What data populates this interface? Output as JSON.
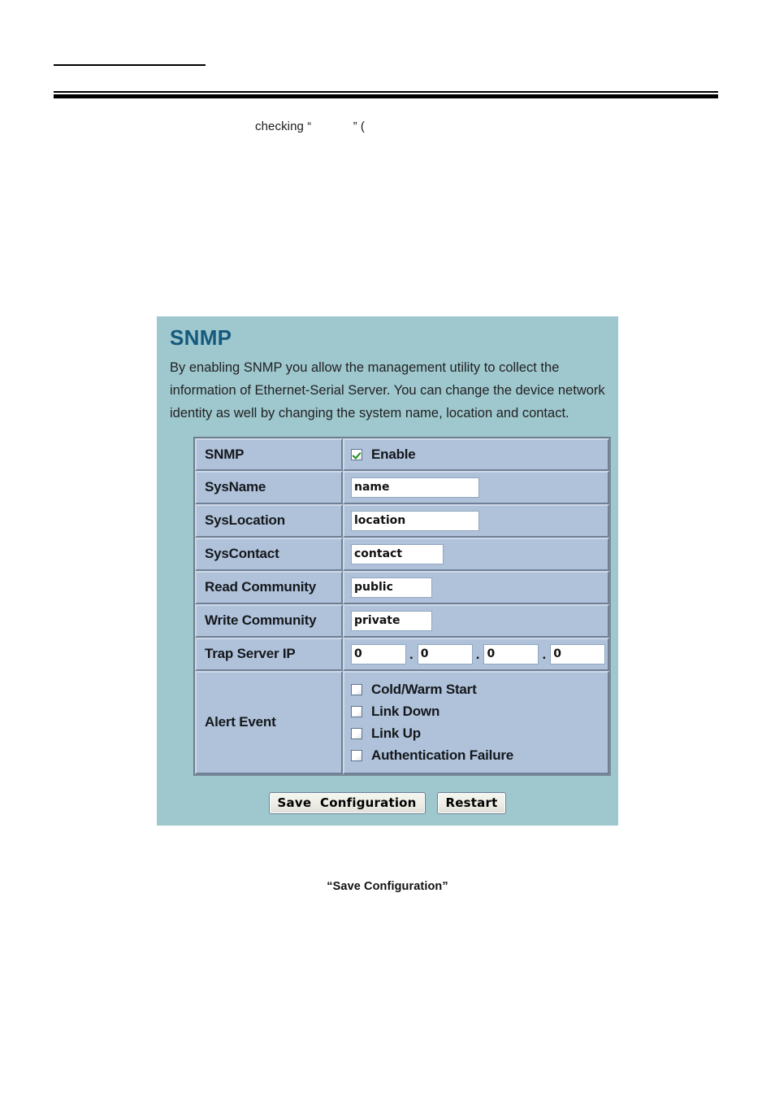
{
  "document": {
    "partial_text": "checking “            ” (",
    "figure_caption": "“Save Configuration”"
  },
  "panel": {
    "title": "SNMP",
    "description": "By enabling SNMP you allow the management utility to collect the information of Ethernet-Serial Server. You can change the device network identity as well by changing the system name, location and contact.",
    "background_color": "#9ec7ce",
    "title_color": "#15597c",
    "cell_color": "#b0c2da"
  },
  "form": {
    "rows": {
      "snmp": {
        "label": "SNMP",
        "enable_label": "Enable",
        "enabled": true
      },
      "sysname": {
        "label": "SysName",
        "value": "name"
      },
      "syslocation": {
        "label": "SysLocation",
        "value": "location"
      },
      "syscontact": {
        "label": "SysContact",
        "value": "contact"
      },
      "read_community": {
        "label": "Read Community",
        "value": "public"
      },
      "write_community": {
        "label": "Write Community",
        "value": "private"
      },
      "trap_server_ip": {
        "label": "Trap Server IP",
        "octet1": "0",
        "octet2": "0",
        "octet3": "0",
        "octet4": "0",
        "separator": "."
      },
      "alert_event": {
        "label": "Alert Event",
        "options": [
          {
            "label": "Cold/Warm Start",
            "checked": false
          },
          {
            "label": "Link Down",
            "checked": false
          },
          {
            "label": "Link Up",
            "checked": false
          },
          {
            "label": "Authentication Failure",
            "checked": false
          }
        ]
      }
    }
  },
  "buttons": {
    "save": "Save  Configuration",
    "restart": "Restart"
  }
}
